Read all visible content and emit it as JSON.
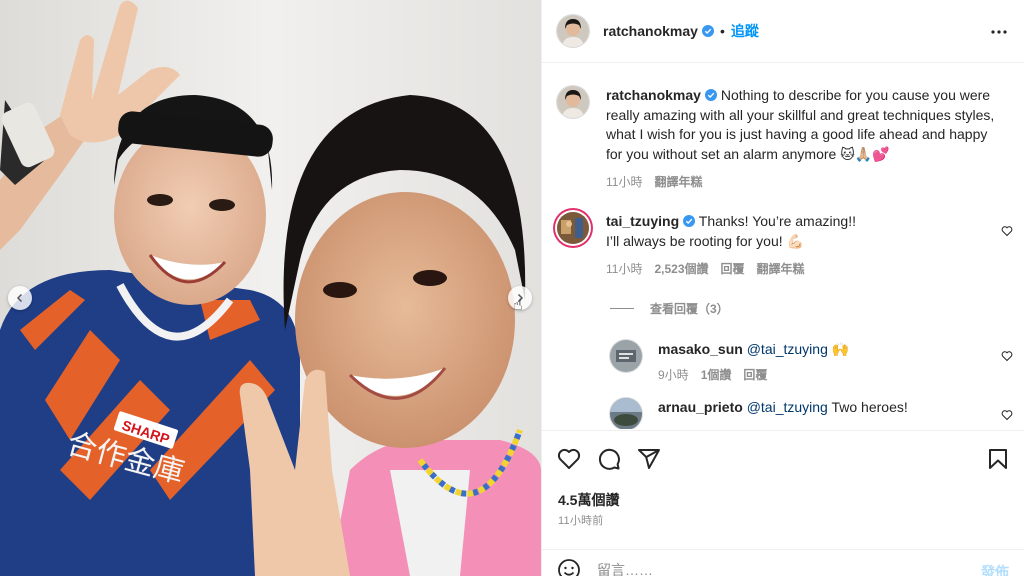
{
  "post_header": {
    "username": "ratchanokmay",
    "separator": "•",
    "follow_label": "追蹤",
    "more_icon": "more-horizontal-icon"
  },
  "caption": {
    "username": "ratchanokmay",
    "text": "Nothing to describe for you cause you were really amazing with all your skillful and great techniques styles, what I wish for you is just having a good life ahead and happy for you without set an alarm anymore 🐱🙏🏼💕",
    "time": "11小時",
    "translate": "翻譯年糕"
  },
  "comments": [
    {
      "username": "tai_tzuying",
      "text": "Thanks! You’re amazing!!\nI’ll always be rooting for you! 💪🏻",
      "time": "11小時",
      "likes": "2,523個讚",
      "reply": "回覆",
      "translate": "翻譯年糕"
    }
  ],
  "view_replies": "查看回覆（3）",
  "replies": [
    {
      "username": "masako_sun",
      "mention": "@tai_tzuying",
      "text": " 🙌",
      "time": "9小時",
      "likes": "1個讚",
      "reply": "回覆"
    },
    {
      "username": "arnau_prieto",
      "mention": "@tai_tzuying",
      "text": " Two heroes!"
    }
  ],
  "actions": {
    "likes": "4.5萬個讚",
    "time": "11小時前",
    "icons": [
      "heart-icon",
      "comment-icon",
      "share-icon",
      "save-icon"
    ]
  },
  "add_comment": {
    "placeholder": "留言……",
    "post_label": "發佈"
  },
  "colors": {
    "accent": "#0095f6",
    "post_disabled": "#b2dffc",
    "secondary_text": "#8e8e8e",
    "mention": "#00376b",
    "verified": "#3897f0"
  }
}
